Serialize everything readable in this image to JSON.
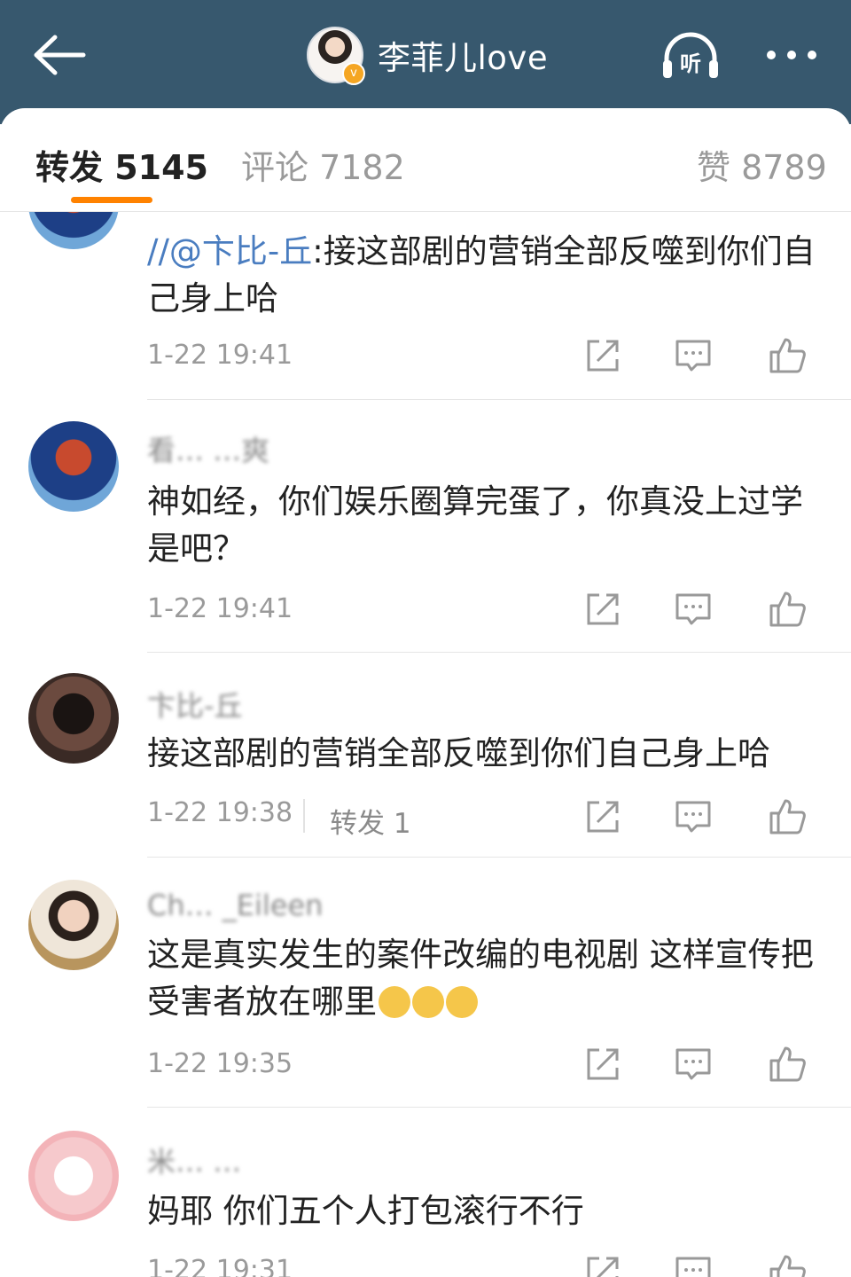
{
  "topbar": {
    "title": "李菲儿love",
    "listen_label": "听"
  },
  "tabs": [
    {
      "label": "转发 5145",
      "active": true
    },
    {
      "label": "评论 7182",
      "active": false
    },
    {
      "label": "赞 8789",
      "active": false
    }
  ],
  "accent_color": "#ff8200",
  "topbar_color": "#37586e",
  "comments": [
    {
      "username": "",
      "mention": "//@卞比-丘",
      "text": ":接这部剧的营销全部反噬到你们自己身上哈",
      "time": "1-22 19:41"
    },
    {
      "username": "看… …爽",
      "text": "神如经，你们娱乐圈算完蛋了，你真没上过学是吧？",
      "time": "1-22 19:41"
    },
    {
      "username": "卞比-丘",
      "text": "接这部剧的营销全部反噬到你们自己身上哈",
      "time": "1-22 19:38",
      "reposts": "转发 1"
    },
    {
      "username": "Ch… _Eileen",
      "text": "这是真实发生的案件改编的电视剧 这样宣传把受害者放在哪里",
      "time": "1-22 19:35"
    },
    {
      "username": "米… …",
      "text": "妈耶 你们五个人打包滚行不行",
      "time": "1-22 19:31"
    }
  ]
}
